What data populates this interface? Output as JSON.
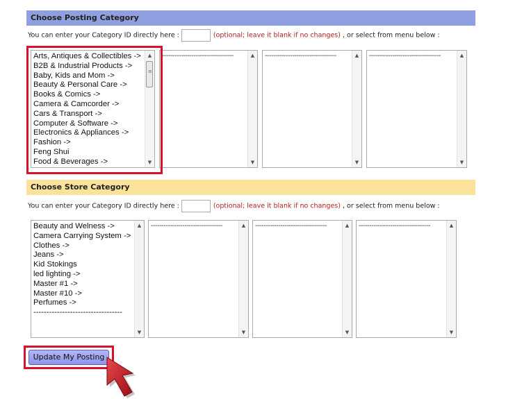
{
  "posting": {
    "header": "Choose Posting Category",
    "id_prompt": "You can enter your Category ID directly here :",
    "id_value": "",
    "optional_note": "(optional; leave it blank if no changes)",
    "menu_prompt": ", or select from menu below :",
    "categories": [
      "Arts, Antiques & Collectibles ->",
      "B2B & Industrial Products ->",
      "Baby, Kids and Mom ->",
      "Beauty & Personal Care ->",
      "Books & Comics ->",
      "Camera & Camcorder ->",
      "Cars & Transport ->",
      "Computer & Software ->",
      "Electronics & Appliances ->",
      "Fashion ->",
      "Feng Shui",
      "Food & Beverages ->"
    ],
    "sub_placeholder": "----------------------------------"
  },
  "store": {
    "header": "Choose Store Category",
    "id_prompt": "You can enter your Category ID directly here :",
    "id_value": "",
    "optional_note": "(optional; leave it blank if no changes)",
    "menu_prompt": ", or select from menu below :",
    "categories": [
      "Beauty and Welness ->",
      "Camera Carrying System ->",
      "Clothes ->",
      "Jeans ->",
      "Kid Stokings",
      "led lighting ->",
      "Master #1 ->",
      "Master #10 ->",
      "Perfumes ->",
      "----------------------------------"
    ],
    "sub_placeholder": "----------------------------------"
  },
  "actions": {
    "update_label": "Update My Posting"
  },
  "colors": {
    "posting_header_bg": "#8f9fdf",
    "store_header_bg": "#fae29a",
    "highlight": "#d7112c",
    "optional_note": "#b22222",
    "button_bg": "#9da2ee"
  },
  "icons": {
    "scroll_up": "scroll-up-arrow-icon",
    "scroll_down": "scroll-down-arrow-icon",
    "pointer": "red-pointer-arrow-icon"
  }
}
